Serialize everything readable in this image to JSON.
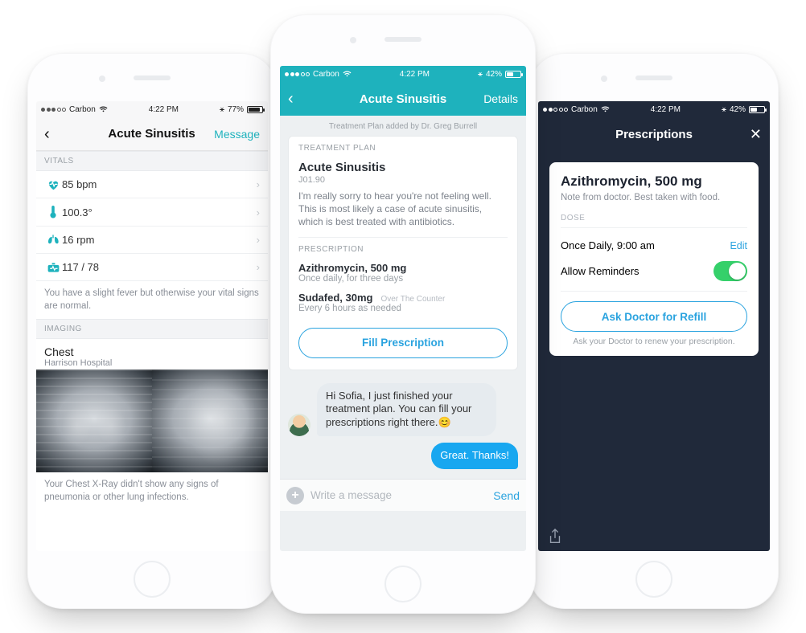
{
  "status": {
    "carrier": "Carbon",
    "time": "4:22 PM",
    "battery_left": "77%",
    "battery_center": "42%",
    "battery_right": "42%"
  },
  "left": {
    "nav_title": "Acute Sinusitis",
    "nav_action": "Message",
    "sections": {
      "vitals_label": "VITALS",
      "imaging_label": "IMAGING"
    },
    "vitals": [
      {
        "icon": "heart-icon",
        "value": "85 bpm"
      },
      {
        "icon": "thermometer-icon",
        "value": "100.3°"
      },
      {
        "icon": "lungs-icon",
        "value": "16 rpm"
      },
      {
        "icon": "bp-icon",
        "value": "117 / 78"
      }
    ],
    "vitals_note": "You have a slight fever but otherwise your vital signs are normal.",
    "imaging": {
      "title": "Chest",
      "subtitle": "Harrison Hospital",
      "note": "Your Chest X-Ray didn't show any signs of pneumonia or other lung infections."
    }
  },
  "center": {
    "nav_title": "Acute Sinusitis",
    "nav_action": "Details",
    "meta": "Treatment Plan added by Dr. Greg Burrell",
    "tp_label": "TREATMENT PLAN",
    "diagnosis": "Acute Sinusitis",
    "code": "J01.90",
    "body": "I'm really sorry to hear you're not feeling well. This is most likely a case of acute sinusitis, which is best treated with antibiotics.",
    "rx_label": "PRESCRIPTION",
    "rx": [
      {
        "name": "Azithromycin, 500 mg",
        "instr": "Once daily, for three days",
        "tag": ""
      },
      {
        "name": "Sudafed, 30mg",
        "instr": "Every 6 hours as needed",
        "tag": "Over The Counter"
      }
    ],
    "fill_button": "Fill Prescription",
    "chat_in": "Hi Sofia, I just finished your treatment plan. You can fill your prescriptions right there.😊",
    "chat_out": "Great. Thanks!",
    "composer_placeholder": "Write a message",
    "send_label": "Send"
  },
  "right": {
    "nav_title": "Prescriptions",
    "drug": "Azithromycin, 500 mg",
    "doctor_note": "Note from doctor. Best taken with food.",
    "dose_label": "DOSE",
    "schedule": "Once Daily, 9:00 am",
    "edit_label": "Edit",
    "reminders_label": "Allow Reminders",
    "refill_button": "Ask Doctor for Refill",
    "refill_note": "Ask your Doctor to renew your prescription."
  }
}
